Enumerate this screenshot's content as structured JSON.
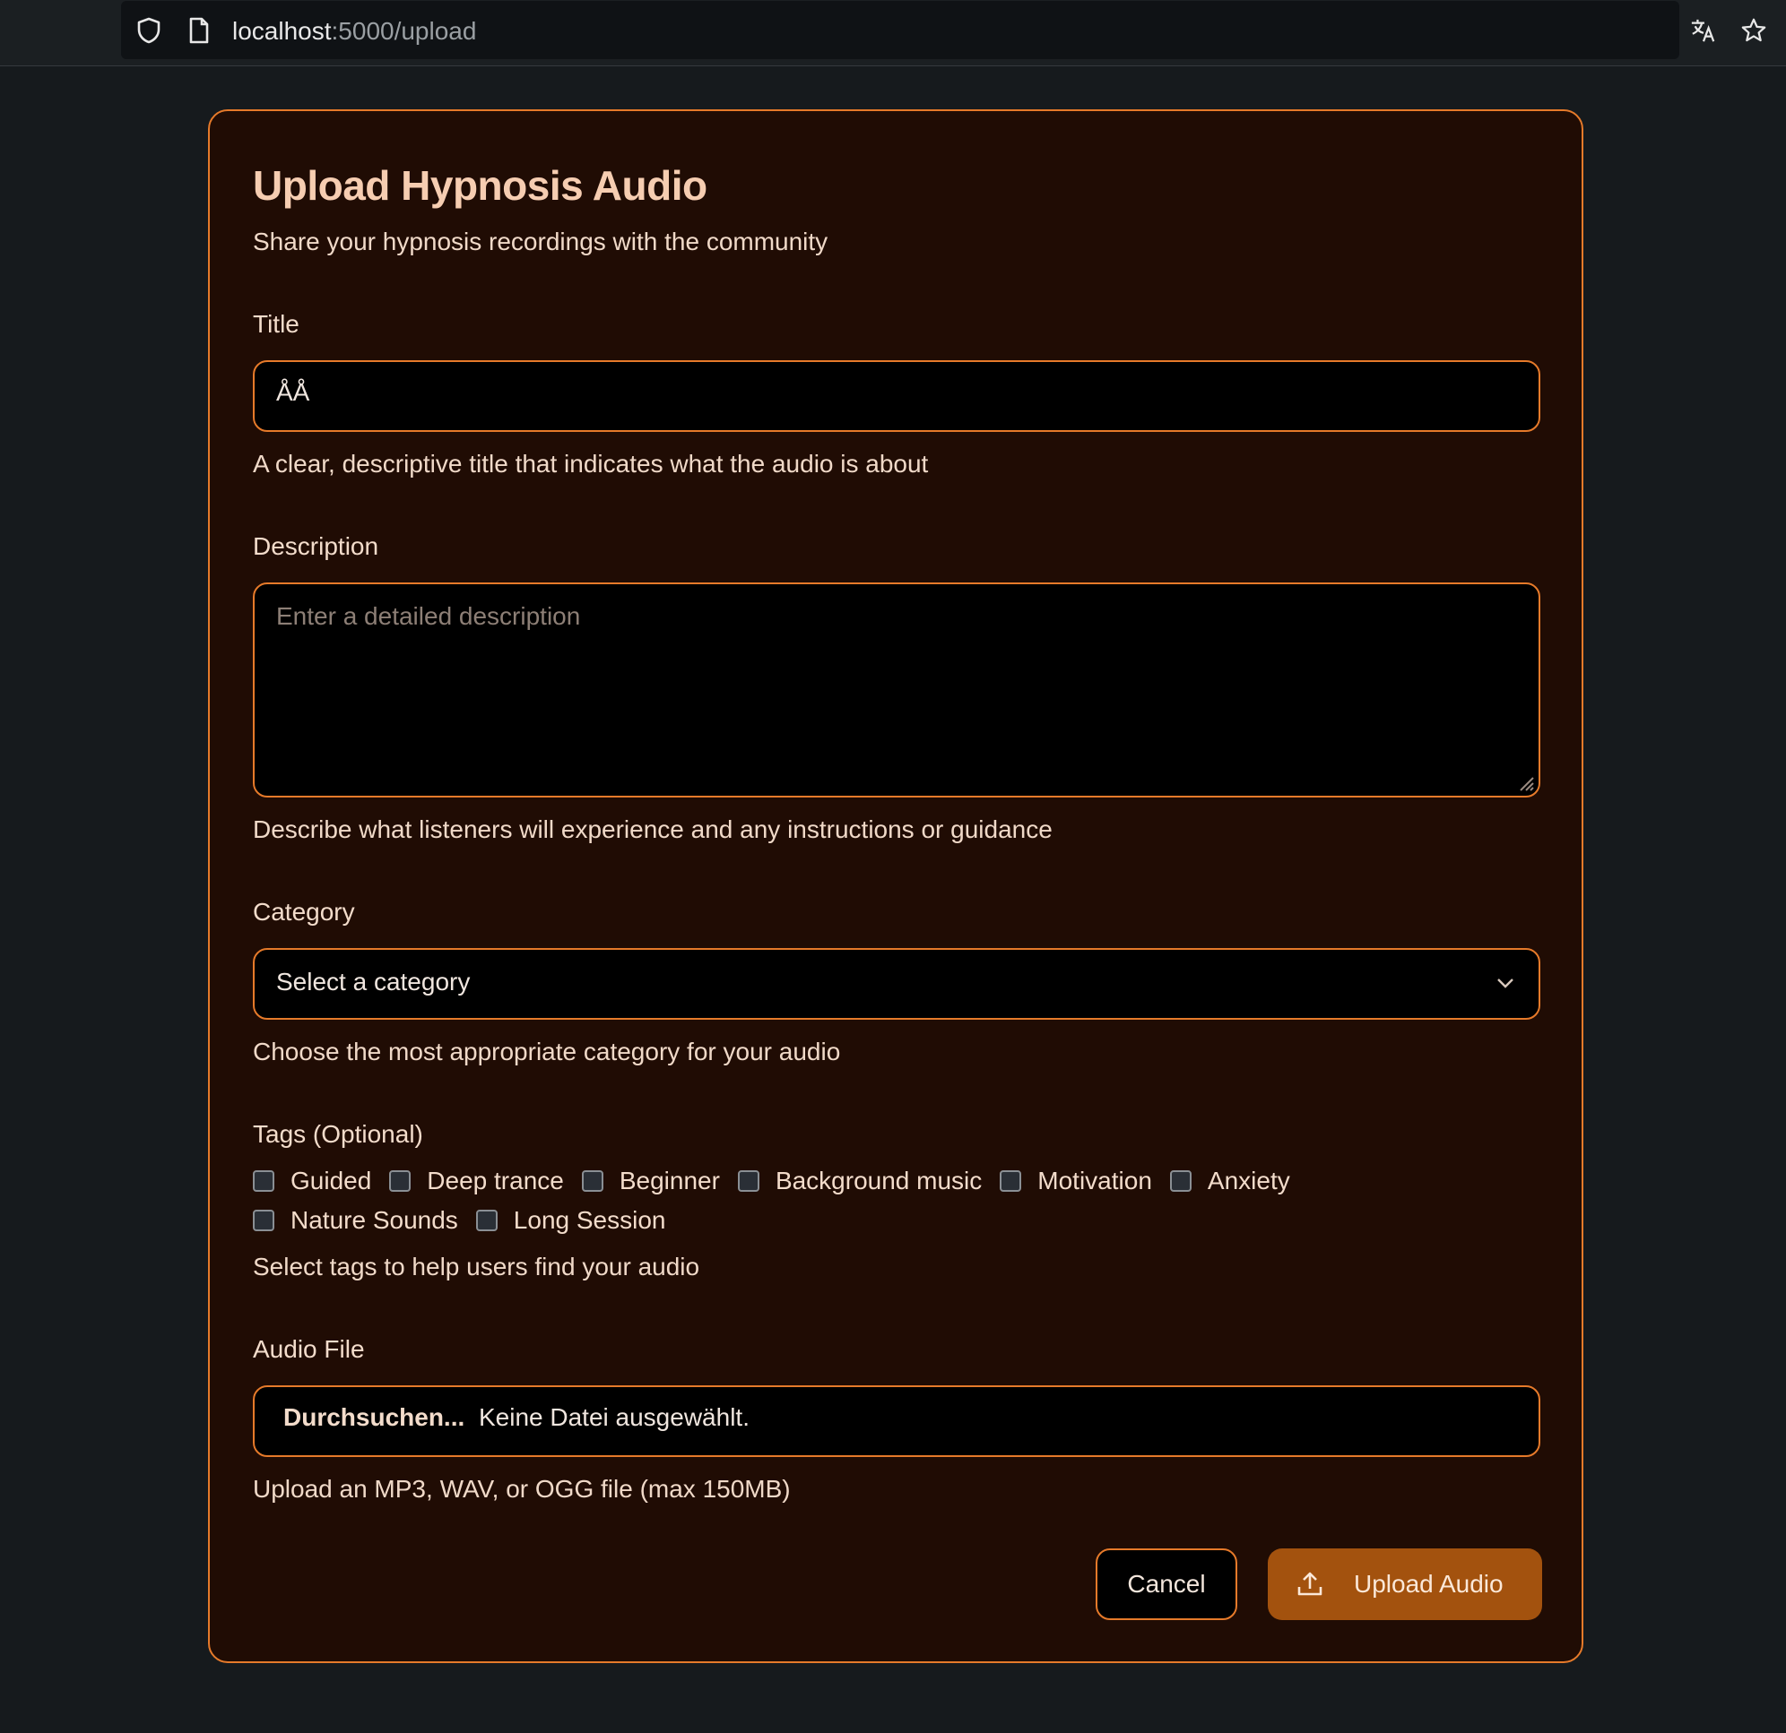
{
  "browser": {
    "url_host": "localhost",
    "url_path": ":5000/upload",
    "icons": [
      "shield-icon",
      "page-icon",
      "translate-icon",
      "star-icon"
    ]
  },
  "form": {
    "title": "Upload Hypnosis Audio",
    "subtitle": "Share your hypnosis recordings with the community",
    "title_field": {
      "label": "Title",
      "value": "ÅÅ",
      "help": "A clear, descriptive title that indicates what the audio is about"
    },
    "description_field": {
      "label": "Description",
      "placeholder": "Enter a detailed description",
      "help": "Describe what listeners will experience and any instructions or guidance"
    },
    "category_field": {
      "label": "Category",
      "selected": "Select a category",
      "help": "Choose the most appropriate category for your audio"
    },
    "tags_field": {
      "label": "Tags (Optional)",
      "row1": [
        "Guided",
        "Deep trance",
        "Beginner",
        "Background music",
        "Motivation",
        "Anxiety"
      ],
      "row2": [
        "Nature Sounds",
        "Long Session"
      ],
      "help": "Select tags to help users find your audio"
    },
    "audio_field": {
      "label": "Audio File",
      "browse_label": "Durchsuchen...",
      "status": "Keine Datei ausgewählt.",
      "help": "Upload an MP3, WAV, or OGG file (max 150MB)"
    },
    "actions": {
      "cancel_label": "Cancel",
      "upload_label": "Upload Audio"
    }
  },
  "colors": {
    "page_bg": "#161a1d",
    "card_bg": "#200c04",
    "accent_border": "#e67a2a",
    "primary_button": "#a3520e",
    "heading": "#f6cdb1"
  }
}
